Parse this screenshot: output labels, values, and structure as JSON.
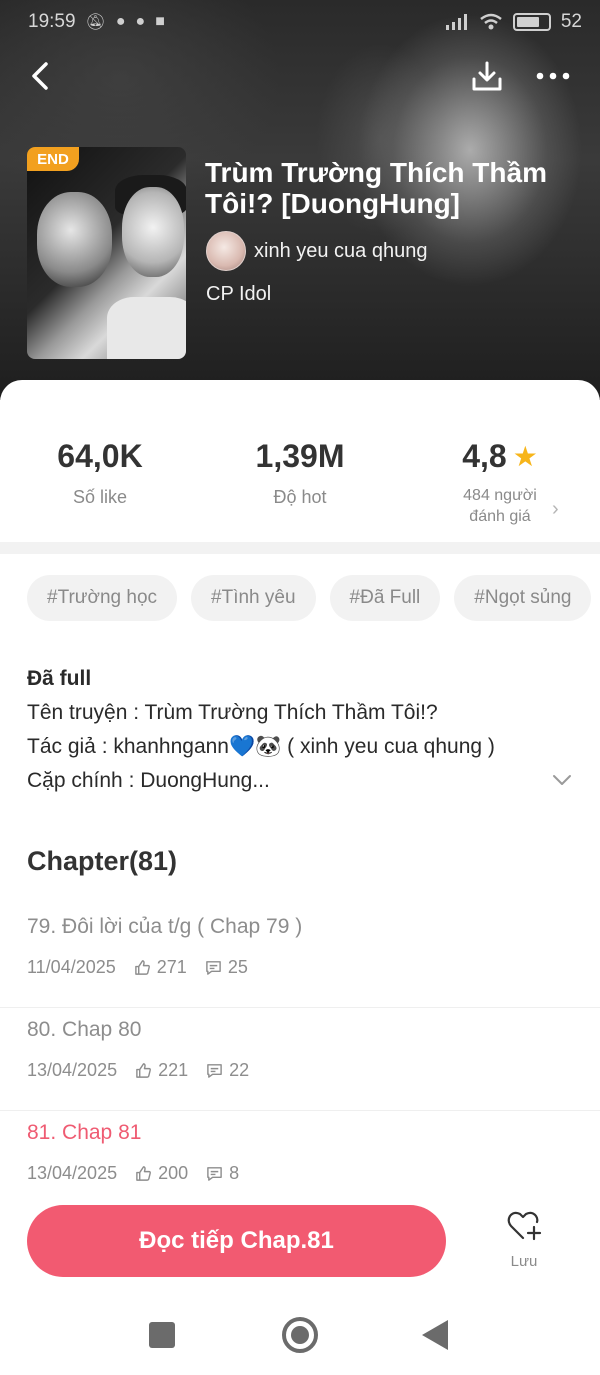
{
  "status_bar": {
    "time": "19:59",
    "left_icons": [
      "mute-bell-icon",
      "messenger-icon",
      "chat-icon",
      "facebook-icon"
    ],
    "battery": "52",
    "right_icons": [
      "signal-icon",
      "wifi-icon",
      "battery-icon"
    ]
  },
  "header": {
    "badge": "END",
    "title": "Trùm Trường Thích Thầm Tôi!? [DuongHung]",
    "author": "xinh yeu cua qhung",
    "category": "CP Idol",
    "icons": [
      "back-arrow-icon",
      "download-icon",
      "more-dots-icon"
    ]
  },
  "stats": {
    "likes": {
      "value": "64,0K",
      "label": "Số like"
    },
    "hot": {
      "value": "1,39M",
      "label": "Độ hot"
    },
    "rating": {
      "value": "4,8",
      "label_line1": "484 người",
      "label_line2": "đánh giá"
    }
  },
  "tags": [
    "#Trường học",
    "#Tình yêu",
    "#Đã Full",
    "#Ngọt sủng"
  ],
  "description": {
    "status": "Đã full",
    "line1": "Tên truyện : Trùm Trường Thích Thầm Tôi!?",
    "line2": "Tác giả : khanhngann💙🐼 ( xinh yeu cua qhung )",
    "line3": "Cặp chính : DuongHung..."
  },
  "chapters": {
    "heading": "Chapter(81)",
    "items": [
      {
        "title": "79. Đôi lời của t/g ( Chap 79 )",
        "date": "11/04/2025",
        "likes": "271",
        "comments": "25"
      },
      {
        "title": "80. Chap 80",
        "date": "13/04/2025",
        "likes": "221",
        "comments": "22"
      },
      {
        "title": "81. Chap 81",
        "date": "13/04/2025",
        "likes": "200",
        "comments": "8"
      }
    ]
  },
  "bottom": {
    "read_button": "Đọc tiếp Chap.81",
    "save_label": "Lưu"
  },
  "colors": {
    "accent": "#f25a71",
    "active_chapter": "#ef5b72",
    "end_badge": "#f2a01f",
    "star": "#f7b51a"
  }
}
